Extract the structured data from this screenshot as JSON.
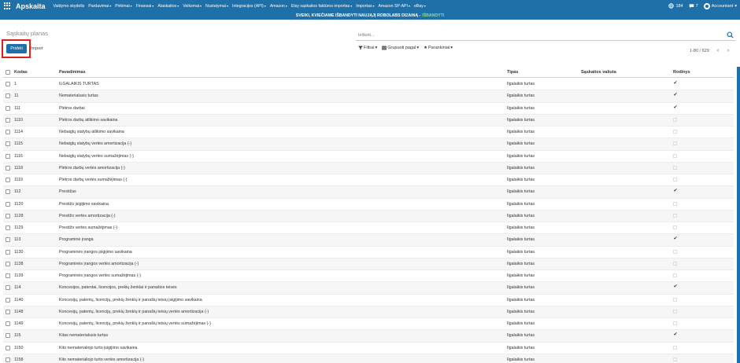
{
  "app": {
    "brand": "Apskaita"
  },
  "menu": [
    "Valdymo skydelis",
    "Pardavimai",
    "Pirkimai",
    "Finansai",
    "Ataskaitos",
    "Veiksmai",
    "Nustatymai",
    "Integracijos (API)",
    "Amazon",
    "Etsy sąskaitos faktūros importas",
    "Importas",
    "Amazon SP-API",
    "eBay"
  ],
  "topbar_right": {
    "messages_count": "184",
    "chat_count": "7",
    "user": "Accountant"
  },
  "banner": {
    "text": "SVEIKI, KVIEČIAME IŠBANDYTI NAUJĄJĮ ROBOLABS DIZAINĄ -",
    "cta": "IŠBANDYTI"
  },
  "breadcrumb": "Sąskaitų planas",
  "buttons": {
    "create": "Pridėti",
    "import": "Import"
  },
  "search": {
    "placeholder": "Ieškoti..."
  },
  "filters": {
    "filter": "Filtrai",
    "group_by": "Grupuoti pagal",
    "favorites": "Parankiniai"
  },
  "pager": {
    "range": "1-80 / 629",
    "prev": "‹",
    "next": "›"
  },
  "columns": {
    "code": "Kodas",
    "name": "Pavadinimas",
    "type": "Tipas",
    "currency": "Sąskaitos valiuta",
    "visible": "Rodinys"
  },
  "accent_color": "#1f6fa8",
  "rows": [
    {
      "code": "1",
      "name": "ILGALAIKIS TURTAS",
      "type": "Ilgalaikis turtas",
      "visible": true
    },
    {
      "code": "11",
      "name": "Nematerialusis turtas",
      "type": "Ilgalaikis turtas",
      "visible": true
    },
    {
      "code": "111",
      "name": "Plėtros darbai",
      "type": "Ilgalaikis turtas",
      "visible": true
    },
    {
      "code": "1110",
      "name": "Plėtros darbų atlikimo savikaina",
      "type": "Ilgalaikis turtas",
      "visible": false
    },
    {
      "code": "1114",
      "name": "Nebaigtų statybų atlikimo savikaina",
      "type": "Ilgalaikis turtas",
      "visible": false
    },
    {
      "code": "1115",
      "name": "Nebaigtų statybų vertės amortizacija (-)",
      "type": "Ilgalaikis turtas",
      "visible": false
    },
    {
      "code": "1116",
      "name": "Nebaigtų statybų vertės sumažėjimas (-)",
      "type": "Ilgalaikis turtas",
      "visible": false
    },
    {
      "code": "1118",
      "name": "Plėtros darbų vertės amortizacija (-)",
      "type": "Ilgalaikis turtas",
      "visible": false
    },
    {
      "code": "1119",
      "name": "Plėtros darbų vertės sumažėjimas (-)",
      "type": "Ilgalaikis turtas",
      "visible": false
    },
    {
      "code": "112",
      "name": "Prestižas",
      "type": "Ilgalaikis turtas",
      "visible": true
    },
    {
      "code": "1120",
      "name": "Prestižo įsigijimo savikaina",
      "type": "Ilgalaikis turtas",
      "visible": false
    },
    {
      "code": "1128",
      "name": "Prestižo vertės amortizacija (-)",
      "type": "Ilgalaikis turtas",
      "visible": false
    },
    {
      "code": "1129",
      "name": "Prestižo vertės sumažėjimas (-)",
      "type": "Ilgalaikis turtas",
      "visible": false
    },
    {
      "code": "113",
      "name": "Programinė įranga",
      "type": "Ilgalaikis turtas",
      "visible": true
    },
    {
      "code": "1130",
      "name": "Programinės įrangos įsigijimo savikaina",
      "type": "Ilgalaikis turtas",
      "visible": false
    },
    {
      "code": "1138",
      "name": "Programinės įrangos vertės amortizacija (-)",
      "type": "Ilgalaikis turtas",
      "visible": false
    },
    {
      "code": "1139",
      "name": "Programinės įrangos vertės sumažėjimas (-)",
      "type": "Ilgalaikis turtas",
      "visible": false
    },
    {
      "code": "114",
      "name": "Koncesijos, patentai, licencijos, prekių ženklai ir panašios teisės",
      "type": "Ilgalaikis turtas",
      "visible": true
    },
    {
      "code": "1140",
      "name": "Koncesijų, patentų, licencijų, prekių ženklų ir panašių teisių įsigijimo savikaina",
      "type": "Ilgalaikis turtas",
      "visible": false
    },
    {
      "code": "1148",
      "name": "Koncesijų, patentų, licencijų, prekių ženklų ir panašių teisių vertės amortizacija (-)",
      "type": "Ilgalaikis turtas",
      "visible": false
    },
    {
      "code": "1149",
      "name": "Koncesijų, patentų, licencijų, prekių ženklų ir panašių teisių vertės sumažėjimas (-)",
      "type": "Ilgalaikis turtas",
      "visible": false
    },
    {
      "code": "115",
      "name": "Kitas nematerialusis turtas",
      "type": "Ilgalaikis turtas",
      "visible": true
    },
    {
      "code": "1150",
      "name": "Kito nematerialiojo turto įsigijimo savikaina",
      "type": "Ilgalaikis turtas",
      "visible": false
    },
    {
      "code": "1158",
      "name": "Kito nematerialiojo turto vertės amortizacija (-)",
      "type": "Ilgalaikis turtas",
      "visible": false
    }
  ]
}
